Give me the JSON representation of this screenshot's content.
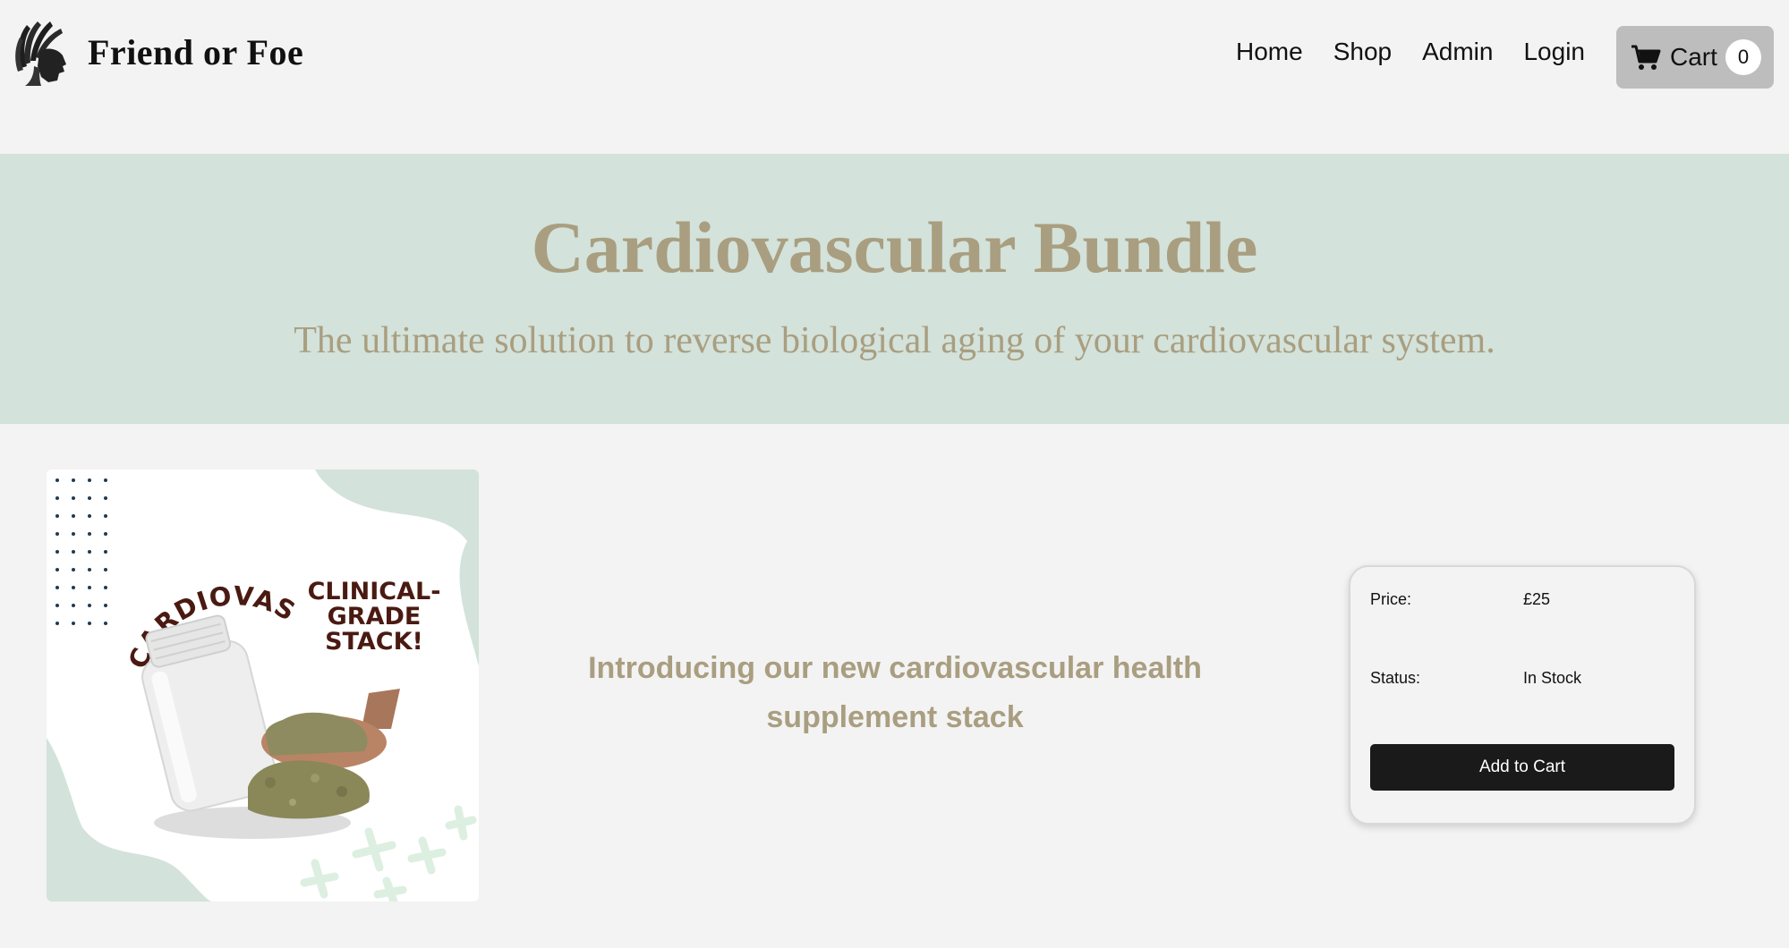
{
  "brand": {
    "name": "Friend or Foe",
    "logo_icon": "native-chief-headdress-logo"
  },
  "nav": {
    "links": [
      {
        "label": "Home"
      },
      {
        "label": "Shop"
      },
      {
        "label": "Admin"
      },
      {
        "label": "Login"
      }
    ],
    "cart": {
      "label": "Cart",
      "count": "0",
      "icon": "shopping-cart-icon"
    }
  },
  "hero": {
    "title": "Cardiovascular Bundle",
    "subtitle": "The ultimate solution to reverse biological aging of your cardiovascular system.",
    "background": "#d3e2da",
    "text_color": "#a99e80"
  },
  "product": {
    "image": {
      "arc_text": "CARDIOVASCULAR",
      "badge_lines": [
        "CLINICAL-",
        "GRADE",
        "STACK!"
      ]
    },
    "intro": "Introducing our new cardiovascular health supplement stack",
    "price_label": "Price:",
    "price_value": "£25",
    "status_label": "Status:",
    "status_value": "In Stock",
    "add_to_cart_label": "Add to Cart"
  }
}
